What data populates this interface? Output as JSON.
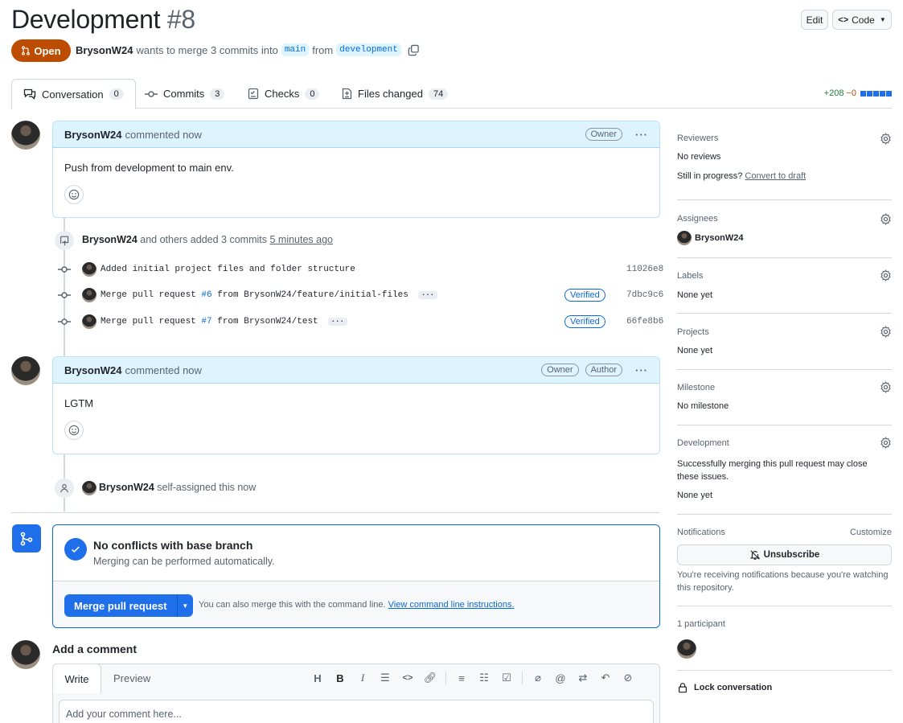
{
  "header": {
    "title": "Development",
    "number": "#8",
    "edit_label": "Edit",
    "code_label": "Code",
    "state_label": "Open",
    "author": "BrysonW24",
    "merge_text": "wants to merge 3 commits into",
    "base_branch": "main",
    "from_text": "from",
    "head_branch": "development"
  },
  "tabs": [
    {
      "label": "Conversation",
      "count": "0"
    },
    {
      "label": "Commits",
      "count": "3"
    },
    {
      "label": "Checks",
      "count": "0"
    },
    {
      "label": "Files changed",
      "count": "74"
    }
  ],
  "diffstat": {
    "additions": "+208",
    "deletions": "−0"
  },
  "comment1": {
    "author": "BrysonW24",
    "action": "commented now",
    "badges": [
      "Owner"
    ],
    "body": "Push from development to main env."
  },
  "commits_event": {
    "author": "BrysonW24",
    "text": "and others added 3 commits",
    "time": "5 minutes ago",
    "items": [
      {
        "pre": "Added initial project files and folder structure",
        "pr": "",
        "post": "",
        "verified": "",
        "sha": "11026e8"
      },
      {
        "pre": "Merge pull request ",
        "pr": "#6",
        "post": " from BrysonW24/feature/initial-files",
        "verified": "Verified",
        "sha": "7dbc9c6"
      },
      {
        "pre": "Merge pull request ",
        "pr": "#7",
        "post": " from BrysonW24/test",
        "verified": "Verified",
        "sha": "66fe8b6"
      }
    ]
  },
  "comment2": {
    "author": "BrysonW24",
    "action": "commented now",
    "badge_owner": "Owner",
    "badge_author": "Author",
    "body": "LGTM"
  },
  "assign_event": {
    "author": "BrysonW24",
    "text": "self-assigned this now"
  },
  "merge": {
    "title": "No conflicts with base branch",
    "subtitle": "Merging can be performed automatically.",
    "button": "Merge pull request",
    "hint": "You can also merge this with the command line.",
    "link": "View command line instructions."
  },
  "add_comment": {
    "heading": "Add a comment",
    "write_tab": "Write",
    "preview_tab": "Preview",
    "placeholder": "Add your comment here..."
  },
  "sidebar": {
    "reviewers": {
      "title": "Reviewers",
      "value": "No reviews",
      "progress": "Still in progress?",
      "draft_link": "Convert to draft"
    },
    "assignees": {
      "title": "Assignees",
      "value": "BrysonW24"
    },
    "labels": {
      "title": "Labels",
      "value": "None yet"
    },
    "projects": {
      "title": "Projects",
      "value": "None yet"
    },
    "milestone": {
      "title": "Milestone",
      "value": "No milestone"
    },
    "development": {
      "title": "Development",
      "desc": "Successfully merging this pull request may close these issues.",
      "value": "None yet"
    },
    "notifications": {
      "title": "Notifications",
      "customize": "Customize",
      "button": "Unsubscribe",
      "desc": "You're receiving notifications because you're watching this repository."
    },
    "participants": {
      "title": "1 participant"
    },
    "lock": {
      "label": "Lock conversation"
    }
  },
  "colors": {
    "accent": "#0969da",
    "open_state": "#bc4c00",
    "merge_button": "#1f6feb"
  }
}
